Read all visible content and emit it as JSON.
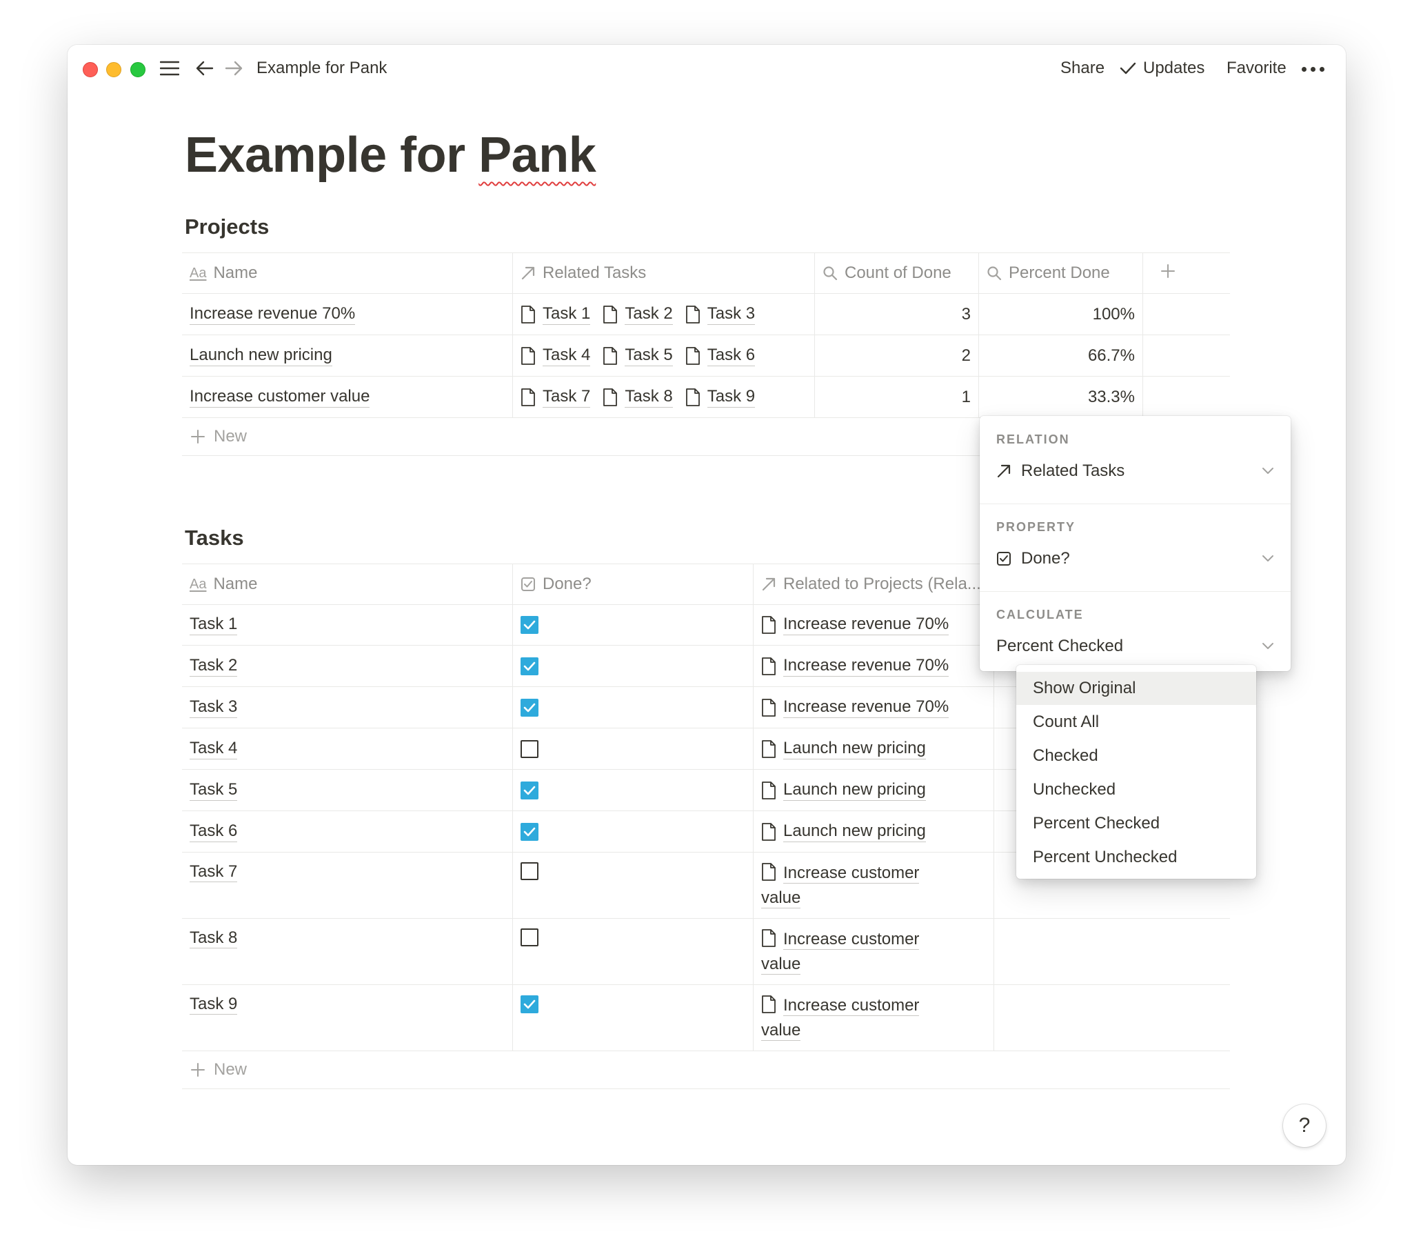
{
  "window": {
    "breadcrumb": "Example for Pank",
    "actions": {
      "share": "Share",
      "updates": "Updates",
      "favorite": "Favorite"
    }
  },
  "page": {
    "title_part1": "Example for ",
    "title_part2": "Pank"
  },
  "projects": {
    "title": "Projects",
    "columns": {
      "name": "Name",
      "related": "Related Tasks",
      "count": "Count of Done",
      "percent": "Percent Done"
    },
    "rows": [
      {
        "name": "Increase revenue 70%",
        "tasks": [
          "Task 1",
          "Task 2",
          "Task 3"
        ],
        "count": "3",
        "percent": "100%"
      },
      {
        "name": "Launch new pricing",
        "tasks": [
          "Task 4",
          "Task 5",
          "Task 6"
        ],
        "count": "2",
        "percent": "66.7%"
      },
      {
        "name": "Increase customer value",
        "tasks": [
          "Task 7",
          "Task 8",
          "Task 9"
        ],
        "count": "1",
        "percent": "33.3%"
      }
    ],
    "new_label": "New"
  },
  "tasks": {
    "title": "Tasks",
    "columns": {
      "name": "Name",
      "done": "Done?",
      "related": "Related to Projects (Rela..."
    },
    "rows": [
      {
        "name": "Task 1",
        "done": true,
        "project": "Increase revenue 70%"
      },
      {
        "name": "Task 2",
        "done": true,
        "project": "Increase revenue 70%"
      },
      {
        "name": "Task 3",
        "done": true,
        "project": "Increase revenue 70%"
      },
      {
        "name": "Task 4",
        "done": false,
        "project": "Launch new pricing"
      },
      {
        "name": "Task 5",
        "done": true,
        "project": "Launch new pricing"
      },
      {
        "name": "Task 6",
        "done": true,
        "project": "Launch new pricing"
      },
      {
        "name": "Task 7",
        "done": false,
        "project_line1": "Increase customer",
        "project_line2": "value"
      },
      {
        "name": "Task 8",
        "done": false,
        "project_line1": "Increase customer",
        "project_line2": "value"
      },
      {
        "name": "Task 9",
        "done": true,
        "project_line1": "Increase customer",
        "project_line2": "value"
      }
    ],
    "new_label": "New"
  },
  "rollup_popup": {
    "relation_label": "RELATION",
    "relation_value": "Related Tasks",
    "property_label": "PROPERTY",
    "property_value": "Done?",
    "calculate_label": "CALCULATE",
    "calculate_value": "Percent Checked"
  },
  "calculate_menu": {
    "options": [
      "Show Original",
      "Count All",
      "Checked",
      "Unchecked",
      "Percent Checked",
      "Percent Unchecked"
    ],
    "highlighted": "Show Original"
  },
  "help_label": "?",
  "colors": {
    "checkbox_on": "#2eaadc",
    "text": "#37352f",
    "muted": "#8e8d8a"
  },
  "icons": [
    "hamburger-icon",
    "back-arrow-icon",
    "forward-arrow-icon",
    "checkmark-icon",
    "more-dots-icon",
    "page-icon",
    "relation-arrow-icon",
    "search-icon",
    "plus-icon",
    "checkbox-icon",
    "chevron-down-icon"
  ]
}
